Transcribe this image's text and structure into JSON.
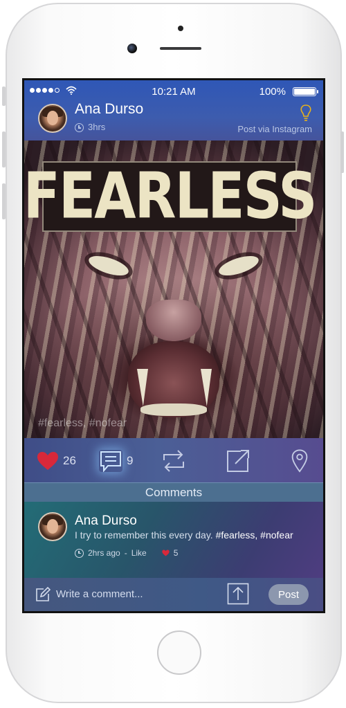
{
  "status_bar": {
    "time": "10:21 AM",
    "battery": "100%"
  },
  "post": {
    "author": "Ana Durso",
    "time_ago": "3hrs",
    "source": "Post via Instagram",
    "image_text": "FEARLESS",
    "image_tags": "#fearless, #nofear"
  },
  "actions": {
    "likes": "26",
    "comments": "9"
  },
  "comments": {
    "header": "Comments",
    "items": [
      {
        "author": "Ana Durso",
        "text": "I try to remember this every day.",
        "tags": "#fearless, #nofear",
        "time_ago": "2hrs ago",
        "separator": "-",
        "like_label": "Like",
        "likes": "5"
      }
    ]
  },
  "composer": {
    "placeholder": "Write a comment...",
    "post_label": "Post"
  },
  "colors": {
    "like_heart": "#d8283a",
    "header_blue": "#3d5cae",
    "bulb_yellow": "#e8b21a"
  },
  "icons": [
    "signal-dots",
    "wifi-icon",
    "battery-icon",
    "lightbulb-icon",
    "clock-icon",
    "heart-icon",
    "comment-icon",
    "repost-icon",
    "share-icon",
    "location-pin-icon",
    "pencil-icon",
    "upload-icon"
  ]
}
